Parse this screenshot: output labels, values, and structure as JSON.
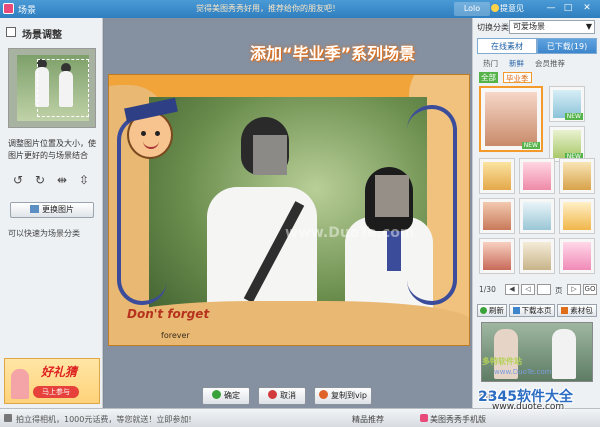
{
  "window": {
    "title": "场景",
    "banner": "觉得美图秀秀好用，推荐给你的朋友吧！",
    "user": "Lolo",
    "tip": "提意见",
    "controls": [
      "—",
      "□",
      "✕"
    ]
  },
  "left_panel": {
    "header": "场景调整",
    "description": "调整图片位置及大小，使图片更好的与场景结合",
    "tools": [
      "rotate-left-icon",
      "rotate-right-icon",
      "flip-horizontal-icon",
      "flip-vertical-icon"
    ],
    "replace_button": "更换图片",
    "hint": "可以快速为场景分类",
    "promo": {
      "title": "好礼猜",
      "button": "马上参与"
    }
  },
  "canvas": {
    "headline": "添加“毕业季”系列场景",
    "frame_text": "Don't forget",
    "frame_subtext": "forever",
    "watermark": "www.DuoTe.com"
  },
  "actions": [
    {
      "label": "确定",
      "color": "#3aa23a"
    },
    {
      "label": "取消",
      "color": "#d23b3b"
    },
    {
      "label": "复制到vip",
      "color": "#e0632a"
    }
  ],
  "right_panel": {
    "category_label": "切换分类",
    "category_value": "可爱场景",
    "tabs": [
      {
        "label": "在线素材",
        "active": true
      },
      {
        "label": "已下载(19)",
        "active": false
      }
    ],
    "subtabs": [
      "热门",
      "新鲜",
      "会员推荐"
    ],
    "filters": [
      "全部",
      "毕业季"
    ],
    "badge": "NEW",
    "pager": {
      "page": "1/30",
      "unit": "页",
      "go": "GO"
    },
    "buttons": [
      "刷新",
      "下载本页",
      "素材包"
    ],
    "ad_label": "国内"
  },
  "statusbar": {
    "left": "拍立得相机，1000元话费，等您就送！立即参加!",
    "right_link": "精品推荐",
    "right_item": "美图秀秀手机版"
  },
  "site_watermark": {
    "name": "2345软件大全",
    "url": "www.duote.com",
    "tag": "多特软件站",
    "tag_url": "www.DuoTe.com"
  },
  "colors": {
    "titlebar": "#3d8ccb",
    "accent": "#f39a2b",
    "frame": "#f0a43a"
  }
}
